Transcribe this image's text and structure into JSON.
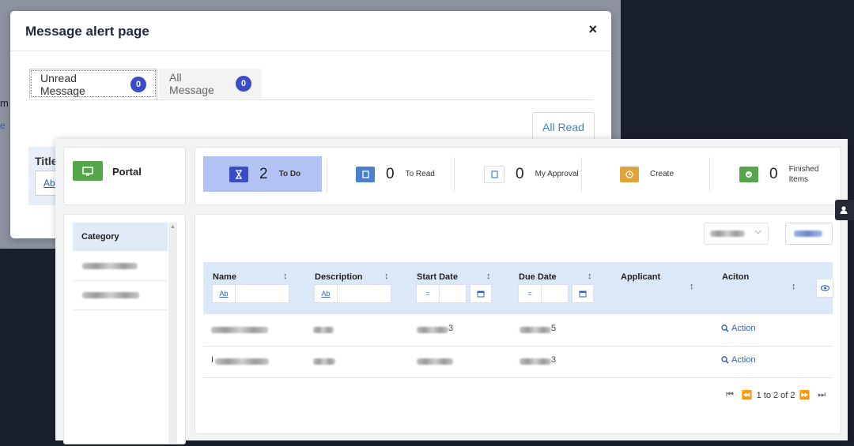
{
  "modal": {
    "title": "Message alert page",
    "close_label": "×",
    "tabs": [
      {
        "label": "Unread Message",
        "count": "0"
      },
      {
        "label": "All Message",
        "count": "0"
      }
    ],
    "all_read_label": "All Read",
    "inner_title": "Title",
    "inner_input_text": "Ab"
  },
  "background": {
    "edge_text": "m",
    "edge_link": "e"
  },
  "portal": {
    "brand_label": "Portal",
    "stats": [
      {
        "count": "2",
        "label": "To Do",
        "color": "#3b4cc9",
        "icon": "hourglass-icon",
        "active": true
      },
      {
        "count": "0",
        "label": "To Read",
        "color": "#4a7fd0",
        "icon": "book-icon"
      },
      {
        "count": "0",
        "label": "My Approval",
        "color": "#ffffff",
        "icon": "document-icon"
      },
      {
        "count": "",
        "label": "Create",
        "color": "#e1a43a",
        "icon": "clock-icon"
      },
      {
        "count": "0",
        "label": "Finished Items",
        "color": "#55a54a",
        "icon": "check-icon"
      }
    ],
    "category": {
      "header": "Category"
    },
    "table": {
      "columns": [
        "Name",
        "Description",
        "Start Date",
        "Due Date",
        "Applicant",
        "Aciton"
      ],
      "filter_text": "Ab",
      "eq_symbol": "=",
      "rows": [
        {
          "name_prefix": "",
          "start_suffix": "3",
          "due_suffix": "5",
          "action": "Action"
        },
        {
          "name_prefix": "I",
          "start_suffix": "",
          "due_suffix": "3",
          "action": "Action"
        }
      ]
    },
    "pagination": {
      "text": "1 to 2 of 2"
    }
  }
}
